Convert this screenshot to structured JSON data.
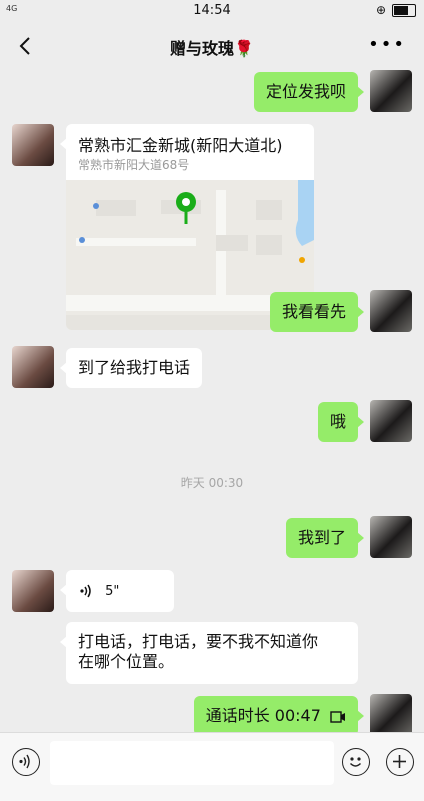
{
  "status_bar": {
    "network": "4G",
    "time": "14:54"
  },
  "header": {
    "title": "赠与玫瑰🌹"
  },
  "messages": {
    "m1": "定位发我呗",
    "location": {
      "title": "常熟市汇金新城(新阳大道北)",
      "address": "常熟市新阳大道68号"
    },
    "m2": "我看看先",
    "m3": "到了给我打电话",
    "m4": "哦",
    "timestamp": "昨天 00:30",
    "m5": "我到了",
    "voice_duration": "5\"",
    "m6_line1": "打电话，打电话，要不我不知道你",
    "m6_line2": "在哪个位置。",
    "m7": "通话时长 00:47"
  },
  "icons": {
    "back": "chevron-left-icon",
    "more": "more-icon",
    "voice": "voice-icon",
    "emoji": "emoji-icon",
    "plus": "plus-icon",
    "call": "phone-icon"
  },
  "colors": {
    "self_bubble": "#95ec69",
    "other_bubble": "#ffffff",
    "background": "#ededed",
    "map_pin": "#1aad19"
  }
}
